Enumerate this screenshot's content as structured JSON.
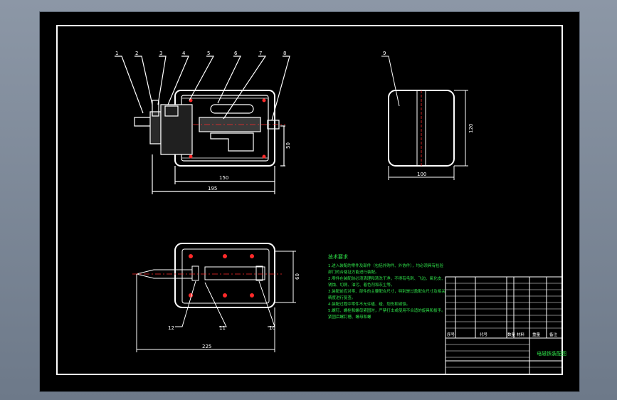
{
  "colors": {
    "background": "#000000",
    "window": "#7d8898",
    "line": "#ffffff",
    "accent_text": "#2fe34a",
    "centerline": "#ff2a2a"
  },
  "drawing": {
    "leader_labels": [
      "1",
      "2",
      "3",
      "4",
      "5",
      "6",
      "7",
      "8"
    ],
    "side_label": "9",
    "bottom_labels": [
      "12",
      "11",
      "10"
    ],
    "dimensions": {
      "front_height": "50",
      "front_inner_width": "150",
      "front_total_width": "195",
      "side_width": "100",
      "side_height": "120",
      "top_height": "60",
      "top_total_width": "225"
    }
  },
  "tech_notes": {
    "title": "技术要求",
    "lines": [
      "1.进入装配的零件及部件（包括外购件、外协件），均必须具有检验",
      "部门的合格证方能进行装配。",
      "2.零件在装配前必须清理和清洗干净，不得有毛刺、飞边、氧化皮、",
      "锈蚀、切屑、油污、着色剂和灰尘等。",
      "3.装配前应对零、部件的主要配合尺寸，特别是过盈配合尺寸及相关",
      "精度进行复查。",
      "4.装配过程中零件不允许磕、碰、划伤和锈蚀。",
      "5.螺钉、螺栓和螺母紧固时，严禁打击或使用不合适的旋具和扳手。",
      "紧固后螺钉槽、螺母和螺"
    ]
  },
  "title_block": {
    "header": {
      "no": "序号",
      "code": "代号",
      "qty": "数量",
      "material": "材料",
      "weight": "重量",
      "note": "备注"
    },
    "drawing_name": "电磁铁装配图"
  }
}
